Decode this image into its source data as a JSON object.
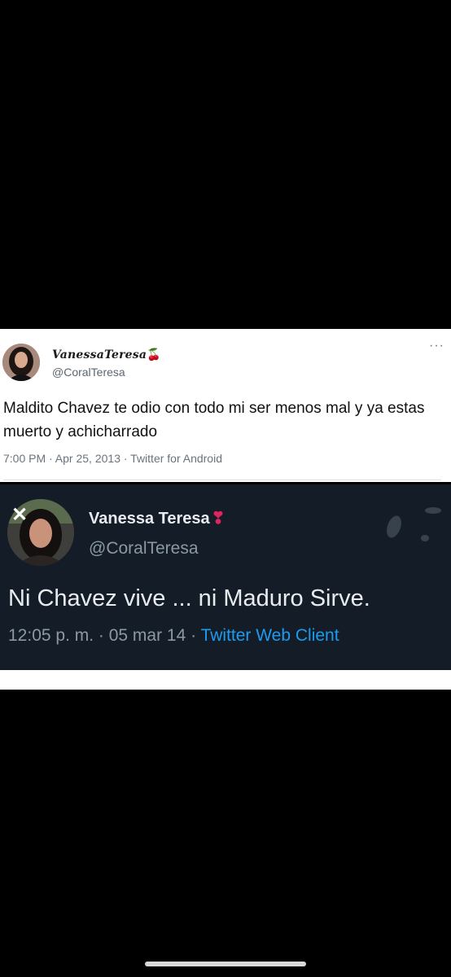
{
  "tweet_light": {
    "display_name": "VanessaTeresa",
    "name_emoji": "🍒",
    "handle": "@CoralTeresa",
    "more": "···",
    "text": "Maldito Chavez te odio con todo mi ser menos mal y ya estas muerto y achicharrado",
    "meta": "7:00 PM · Apr 25, 2013 · Twitter for Android"
  },
  "tweet_dark": {
    "close": "✕",
    "display_name": "Vanessa Teresa",
    "name_emoji": "❣",
    "handle": "@CoralTeresa",
    "text": "Ni Chavez vive ... ni Maduro Sirve.",
    "meta_time": "12:05 p. m. · 05 mar 14 · ",
    "meta_client": "Twitter Web Client"
  },
  "colors": {
    "background": "#000000",
    "dark_card": "#141d27",
    "link_blue": "#1d9bf0"
  }
}
